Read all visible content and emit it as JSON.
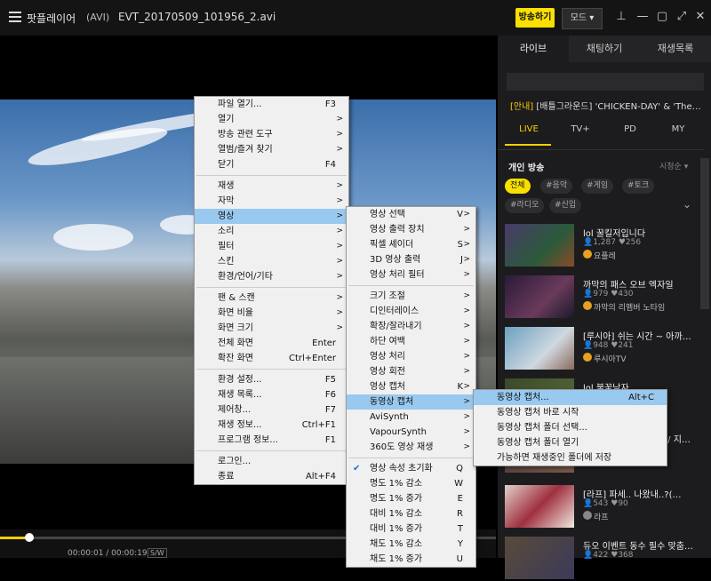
{
  "titlebar": {
    "app_title": "팟플레이어",
    "file_format": "(AVI)",
    "file_name": "EVT_20170509_101956_2.avi",
    "broadcast_label": "방송하기",
    "mode_label": "모드",
    "mode_arrow": "▾",
    "pin_glyph": "⊥",
    "minimize_glyph": "—",
    "maximize_glyph": "▢",
    "fullscreen_glyph": "⤢",
    "close_glyph": "✕"
  },
  "sidebar": {
    "tabs": [
      "라이브",
      "채팅하기",
      "재생목록"
    ],
    "notice_tag": "[안내]",
    "notice_text": "[배틀그라운드] 'CHICKEN-DAY' & 'The…",
    "categories": [
      "LIVE",
      "TV+",
      "PD",
      "MY"
    ],
    "section_title": "개인 방송",
    "sort_label": "시청순 ▾",
    "chips": [
      "전체",
      "#음악",
      "#게임",
      "#토크",
      "#라디오",
      "#신입"
    ],
    "chips_expand": "⌄",
    "items": [
      {
        "title": "lol 꿀킬저입니다",
        "stats": "👤1,287  ♥256",
        "user": "요플레"
      },
      {
        "title": "까막의 패스 오브 엑자일",
        "stats": "👤979  ♥430",
        "user": "까막의 리멤버 노타임"
      },
      {
        "title": "[루시아] 쉬는 시간 ~ 아까…",
        "stats": "👤948  ♥241",
        "user": "루시아TV"
      },
      {
        "title": "lol 불꽃남자",
        "stats": "",
        "user": ""
      },
      {
        "title": "… / 지…",
        "stats": "",
        "user": ""
      },
      {
        "title": "[라프] 파세.. 나왔내..?(…",
        "stats": "👤543  ♥90",
        "user": "라프"
      },
      {
        "title": "듀오 이벤트 동수 필수 맞춤…",
        "stats": "👤422  ♥368",
        "user": ""
      }
    ]
  },
  "main_menu": [
    {
      "label": "파일 열기...",
      "shortcut": "F3",
      "arrow": ""
    },
    {
      "label": "열기",
      "shortcut": "",
      "arrow": ">"
    },
    {
      "label": "방송 관련 도구",
      "shortcut": "",
      "arrow": ">"
    },
    {
      "label": "열범/즐겨 찾기",
      "shortcut": "",
      "arrow": ">"
    },
    {
      "label": "닫기",
      "shortcut": "F4",
      "arrow": ""
    },
    {
      "sep": true
    },
    {
      "label": "재생",
      "shortcut": "",
      "arrow": ">"
    },
    {
      "label": "자막",
      "shortcut": "",
      "arrow": ">"
    },
    {
      "label": "영상",
      "shortcut": "",
      "arrow": ">",
      "hl": true
    },
    {
      "label": "소리",
      "shortcut": "",
      "arrow": ">"
    },
    {
      "label": "필터",
      "shortcut": "",
      "arrow": ">"
    },
    {
      "label": "스킨",
      "shortcut": "",
      "arrow": ">"
    },
    {
      "label": "환경/언어/기타",
      "shortcut": "",
      "arrow": ">"
    },
    {
      "sep": true
    },
    {
      "label": "팬 & 스캔",
      "shortcut": "",
      "arrow": ">"
    },
    {
      "label": "화면 비율",
      "shortcut": "",
      "arrow": ">"
    },
    {
      "label": "화면 크기",
      "shortcut": "",
      "arrow": ">"
    },
    {
      "label": "전체 화면",
      "shortcut": "Enter",
      "arrow": ""
    },
    {
      "label": "확잔 화면",
      "shortcut": "Ctrl+Enter",
      "arrow": ""
    },
    {
      "sep": true
    },
    {
      "label": "환경 설정...",
      "shortcut": "F5",
      "arrow": ""
    },
    {
      "label": "재생 목록...",
      "shortcut": "F6",
      "arrow": ""
    },
    {
      "label": "제어창...",
      "shortcut": "F7",
      "arrow": ""
    },
    {
      "label": "재생 정보...",
      "shortcut": "Ctrl+F1",
      "arrow": ""
    },
    {
      "label": "프로그램 정보...",
      "shortcut": "F1",
      "arrow": ""
    },
    {
      "sep": true
    },
    {
      "label": "로그인...",
      "shortcut": "",
      "arrow": ""
    },
    {
      "label": "종료",
      "shortcut": "Alt+F4",
      "arrow": ""
    }
  ],
  "video_menu": [
    {
      "label": "영상 선택",
      "shortcut": "V",
      "arrow": ">"
    },
    {
      "label": "영상 출력 장치",
      "shortcut": "",
      "arrow": ">"
    },
    {
      "label": "픽셀 셰이더",
      "shortcut": "S",
      "arrow": ">"
    },
    {
      "label": "3D 영상 출력",
      "shortcut": "J",
      "arrow": ">"
    },
    {
      "label": "영상 처리 필터",
      "shortcut": "",
      "arrow": ">"
    },
    {
      "sep": true
    },
    {
      "label": "크기 조절",
      "shortcut": "",
      "arrow": ">"
    },
    {
      "label": "디인터레이스",
      "shortcut": "",
      "arrow": ">"
    },
    {
      "label": "확장/잘라내기",
      "shortcut": "",
      "arrow": ">"
    },
    {
      "label": "하단 여백",
      "shortcut": "",
      "arrow": ">"
    },
    {
      "label": "영상 처리",
      "shortcut": "",
      "arrow": ">"
    },
    {
      "label": "영상 회전",
      "shortcut": "",
      "arrow": ">"
    },
    {
      "label": "영상 캡처",
      "shortcut": "K",
      "arrow": ">"
    },
    {
      "label": "동영상 캡처",
      "shortcut": "",
      "arrow": ">",
      "hl": true
    },
    {
      "label": "AviSynth",
      "shortcut": "",
      "arrow": ">"
    },
    {
      "label": "VapourSynth",
      "shortcut": "",
      "arrow": ">"
    },
    {
      "label": "360도 영상 재생",
      "shortcut": "",
      "arrow": ">"
    },
    {
      "sep": true
    },
    {
      "label": "영상 속성 초기화",
      "shortcut": "Q",
      "arrow": "",
      "check": "✔"
    },
    {
      "label": "명도 1% 감소",
      "shortcut": "W",
      "arrow": ""
    },
    {
      "label": "명도 1% 증가",
      "shortcut": "E",
      "arrow": ""
    },
    {
      "label": "대비 1% 감소",
      "shortcut": "R",
      "arrow": ""
    },
    {
      "label": "대비 1% 증가",
      "shortcut": "T",
      "arrow": ""
    },
    {
      "label": "채도 1% 감소",
      "shortcut": "Y",
      "arrow": ""
    },
    {
      "label": "채도 1% 증가",
      "shortcut": "U",
      "arrow": ""
    }
  ],
  "capture_menu": [
    {
      "label": "동영상 캡처...",
      "shortcut": "Alt+C",
      "arrow": "",
      "hl": true
    },
    {
      "label": "동영상 캡처 바로 시작",
      "shortcut": "",
      "arrow": ""
    },
    {
      "label": "동영상 캡처 폴더 선택...",
      "shortcut": "",
      "arrow": ""
    },
    {
      "label": "동영상 캡처 폴더 열기",
      "shortcut": "",
      "arrow": ""
    },
    {
      "label": "가능하면 재생중인 폴더에 저장",
      "shortcut": "",
      "arrow": ""
    }
  ],
  "controls": {
    "time": "00:00:01 / 00:00:19",
    "speed": "S/W",
    "seek_fraction": 0.06
  },
  "colors": {
    "accent": "#f9e000",
    "menu_highlight": "#99c9ef"
  }
}
